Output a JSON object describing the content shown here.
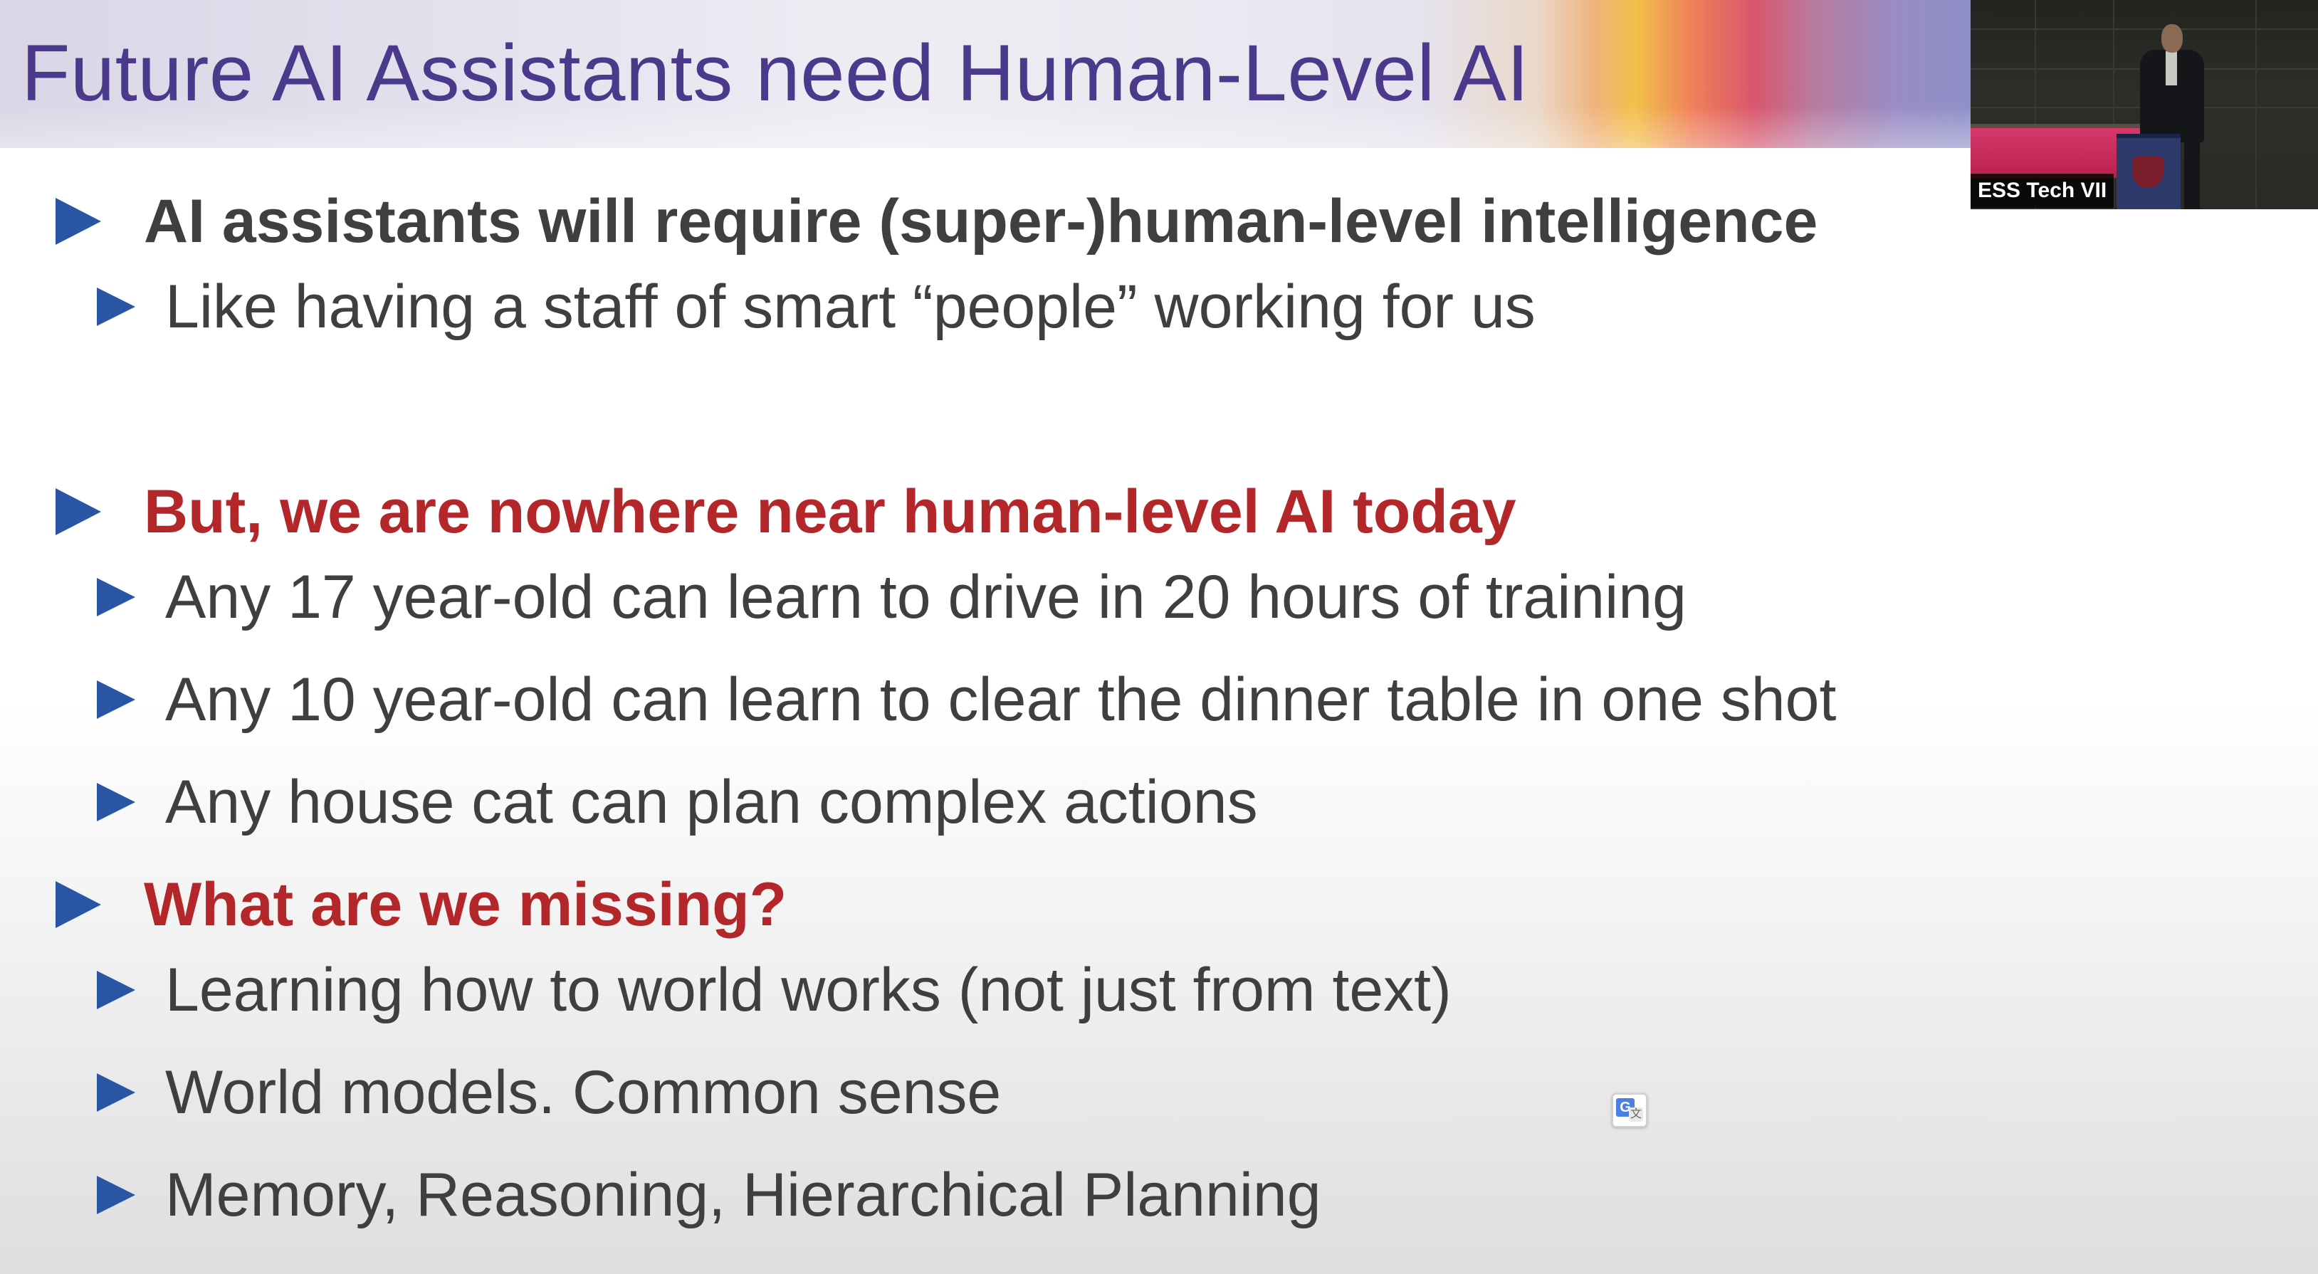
{
  "slide": {
    "title": "Future AI Assistants need Human-Level AI",
    "bullets": [
      {
        "text": "AI assistants will require (super-)human-level intelligence"
      },
      {
        "text": "Like having a staff of smart “people” working for us"
      },
      {
        "text": "But, we are nowhere near human-level AI today"
      },
      {
        "text": "Any 17 year-old can learn to drive in 20 hours of training"
      },
      {
        "text": "Any 10 year-old can learn to clear the dinner table in one shot"
      },
      {
        "text": "Any house cat can plan complex actions"
      },
      {
        "text": "What are we missing?"
      },
      {
        "text": "Learning how to world works (not just from text)"
      },
      {
        "text": "World models. Common sense"
      },
      {
        "text": "Memory, Reasoning, Hierarchical Planning"
      }
    ]
  },
  "webcam": {
    "label": "ESS Tech VII"
  },
  "translate_widget": {
    "glyph_main": "G",
    "glyph_sub": "文"
  },
  "colors": {
    "title": "#4b3a8c",
    "bullet_triangle": "#2a55a5",
    "heading_gray": "#3f3f3f",
    "heading_red": "#b3262a",
    "body_text": "#3f3f3f"
  },
  "icons": [
    "bullet-triangle-icon",
    "translate-icon"
  ]
}
